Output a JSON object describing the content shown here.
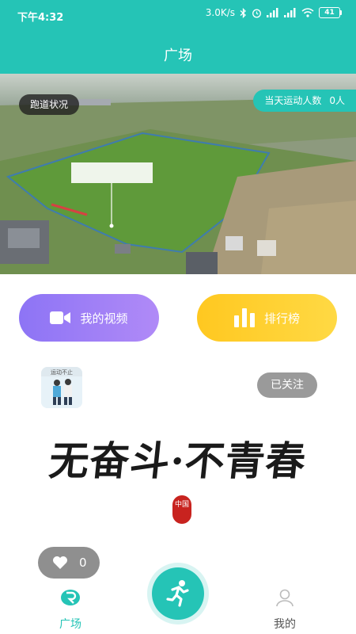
{
  "status_bar": {
    "time": "下午4:32",
    "network_speed": "3.0K/s",
    "icons": [
      "bluetooth-icon",
      "alarm-icon",
      "signal-icon",
      "hd-signal-icon",
      "wifi-icon"
    ],
    "battery": "41"
  },
  "header": {
    "title": "广场"
  },
  "hero": {
    "track_status_label": "跑道状况",
    "active_count_label": "当天运动人数",
    "active_count_value": "0人"
  },
  "actions": {
    "video_label": "我的视频",
    "video_icon": "video-camera-icon",
    "rank_label": "排行榜",
    "rank_icon": "bar-chart-icon"
  },
  "post": {
    "follow_label": "已关注",
    "avatar_text": "运动不止",
    "calligraphy_text": "无奋斗·不青春",
    "seal_text": "中国",
    "like_count": "0"
  },
  "bottom_nav": {
    "home_label": "广场",
    "mine_label": "我的",
    "center_icon": "running-person-icon"
  },
  "colors": {
    "primary": "#25c4b6",
    "video_gradient": [
      "#8d74f5",
      "#b08af7"
    ],
    "rank_gradient": [
      "#ffc820",
      "#ffd944"
    ]
  }
}
